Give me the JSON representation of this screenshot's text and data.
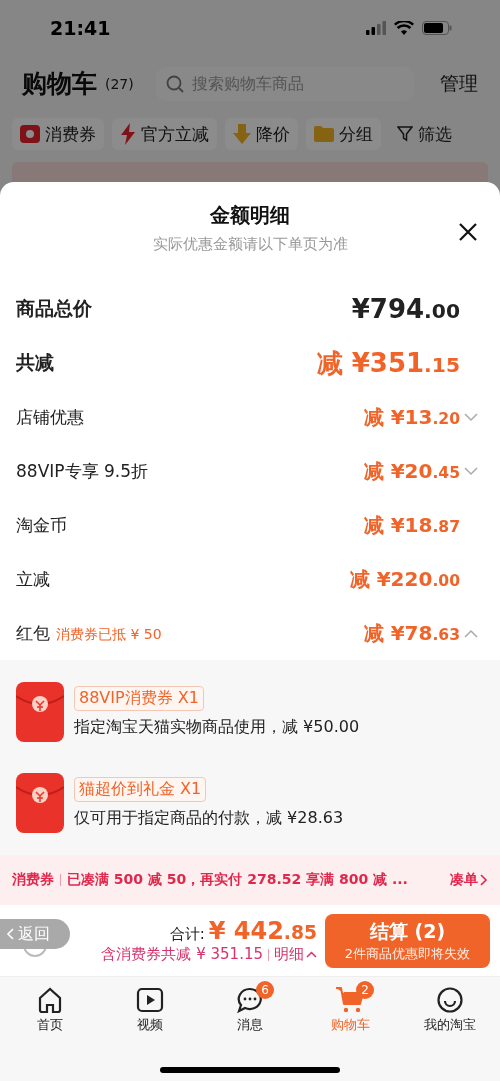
{
  "status_bar": {
    "time": "21:41"
  },
  "header": {
    "title": "购物车",
    "count": "(27)",
    "search": {
      "placeholder": "搜索购物车商品"
    },
    "manage": "管理"
  },
  "filters": [
    {
      "kind": "coupon",
      "label": "消费券"
    },
    {
      "kind": "bolt",
      "label": "官方立减"
    },
    {
      "kind": "price",
      "label": "降价"
    },
    {
      "kind": "folder",
      "label": "分组"
    },
    {
      "kind": "filter",
      "label": "筛选"
    }
  ],
  "sheet": {
    "title": "金额明细",
    "subtitle": "实际优惠金额请以下单页为准",
    "rows": [
      {
        "kind": "total",
        "label": "商品总价",
        "prefix": "",
        "amount": "¥794",
        "cents": ".00"
      },
      {
        "kind": "reduction",
        "label": "共减",
        "prefix": "减",
        "amount": "¥351",
        "cents": ".15"
      },
      {
        "kind": "item",
        "label": "店铺优惠",
        "prefix": "减",
        "amount": "¥13",
        "cents": ".20",
        "expanded": false
      },
      {
        "kind": "item",
        "label": "88VIP专享 9.5折",
        "prefix": "减",
        "amount": "¥20",
        "cents": ".45",
        "expanded": false
      },
      {
        "kind": "item",
        "label": "淘金币",
        "prefix": "减",
        "amount": "¥18",
        "cents": ".87"
      },
      {
        "kind": "item",
        "label": "立减",
        "prefix": "减",
        "amount": "¥220",
        "cents": ".00"
      },
      {
        "kind": "item",
        "label": "红包",
        "note": "消费券已抵 ¥ 50",
        "prefix": "减",
        "amount": "¥78",
        "cents": ".63",
        "expanded": true
      }
    ],
    "coupons": [
      {
        "tag": "88VIP消费券 X1",
        "description": "指定淘宝天猫实物商品使用，减 ¥50.00"
      },
      {
        "tag": "猫超价到礼金 X1",
        "description": "仅可用于指定商品的付款，减 ¥28.63"
      }
    ],
    "promo": {
      "label": "消费券",
      "text": "已凑满 500 减 50，再实付 278.52 享满 800 减 ...",
      "action": "凑单"
    }
  },
  "checkout": {
    "back": "返回",
    "total_label": "合计:",
    "total_amount": "¥ 442",
    "total_cents": ".85",
    "savings": "含消费券共减 ¥ 351.15",
    "details": "明细",
    "button": "结算 (2)",
    "button_note": "2件商品优惠即将失效"
  },
  "tabs": [
    {
      "kind": "home",
      "label": "首页",
      "selected": false
    },
    {
      "kind": "video",
      "label": "视频",
      "selected": false
    },
    {
      "kind": "message",
      "label": "消息",
      "badge": "6",
      "selected": false
    },
    {
      "kind": "cart",
      "label": "购物车",
      "badge": "2",
      "selected": true
    },
    {
      "kind": "profile",
      "label": "我的淘宝",
      "selected": false
    }
  ]
}
